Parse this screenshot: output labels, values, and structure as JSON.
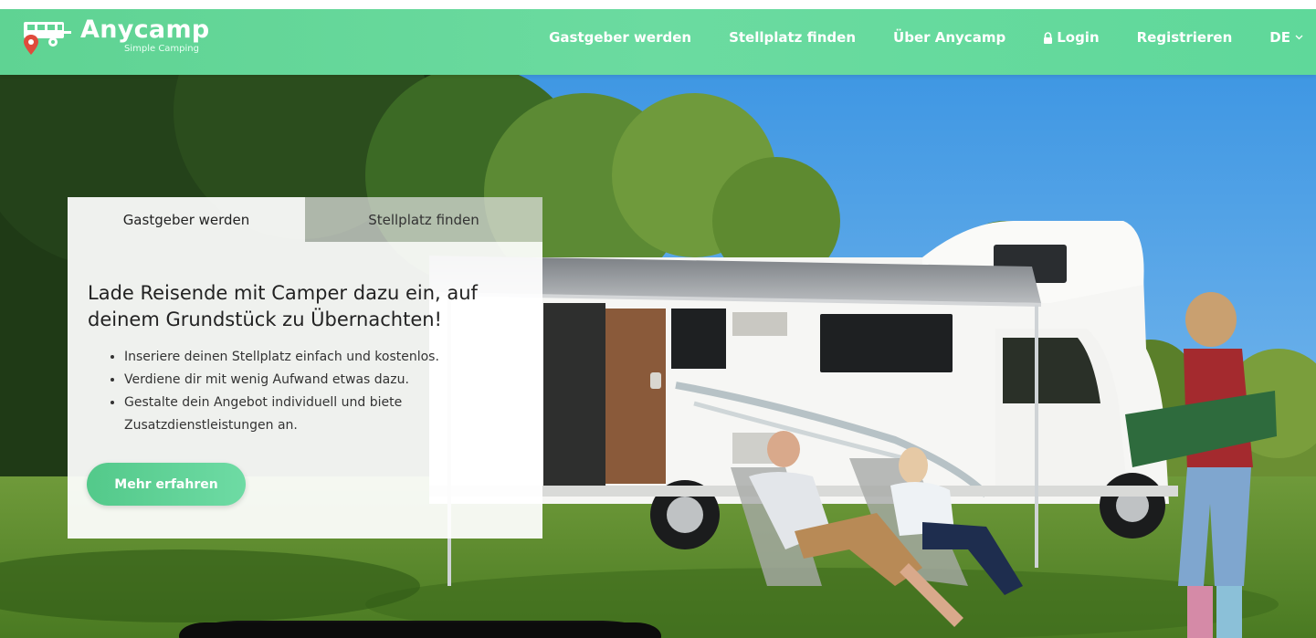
{
  "brand": {
    "name": "Anycamp",
    "tagline": "Simple Camping",
    "icon": "caravan-logo-icon"
  },
  "nav": {
    "items": [
      {
        "label": "Gastgeber werden"
      },
      {
        "label": "Stellplatz finden"
      },
      {
        "label": "Über Anycamp"
      },
      {
        "label": "Login",
        "icon": "lock-icon"
      },
      {
        "label": "Registrieren"
      }
    ],
    "language": {
      "label": "DE",
      "icon": "chevron-down-icon"
    }
  },
  "card": {
    "tabs": [
      {
        "label": "Gastgeber werden",
        "active": true
      },
      {
        "label": "Stellplatz finden",
        "active": false
      }
    ],
    "title": "Lade Reisende mit Camper dazu ein, auf deinem Grundstück zu Übernachten!",
    "bullets": [
      "Inseriere deinen Stellplatz einfach und kostenlos.",
      "Verdiene dir mit wenig Aufwand etwas dazu.",
      "Gestalte dein Angebot individuell und biete Zusatzdienstleistungen an."
    ],
    "button": "Mehr erfahren"
  },
  "colors": {
    "accent": "#5fd393",
    "nav_text": "#ffffff",
    "logo_pin": "#e04b3c"
  }
}
